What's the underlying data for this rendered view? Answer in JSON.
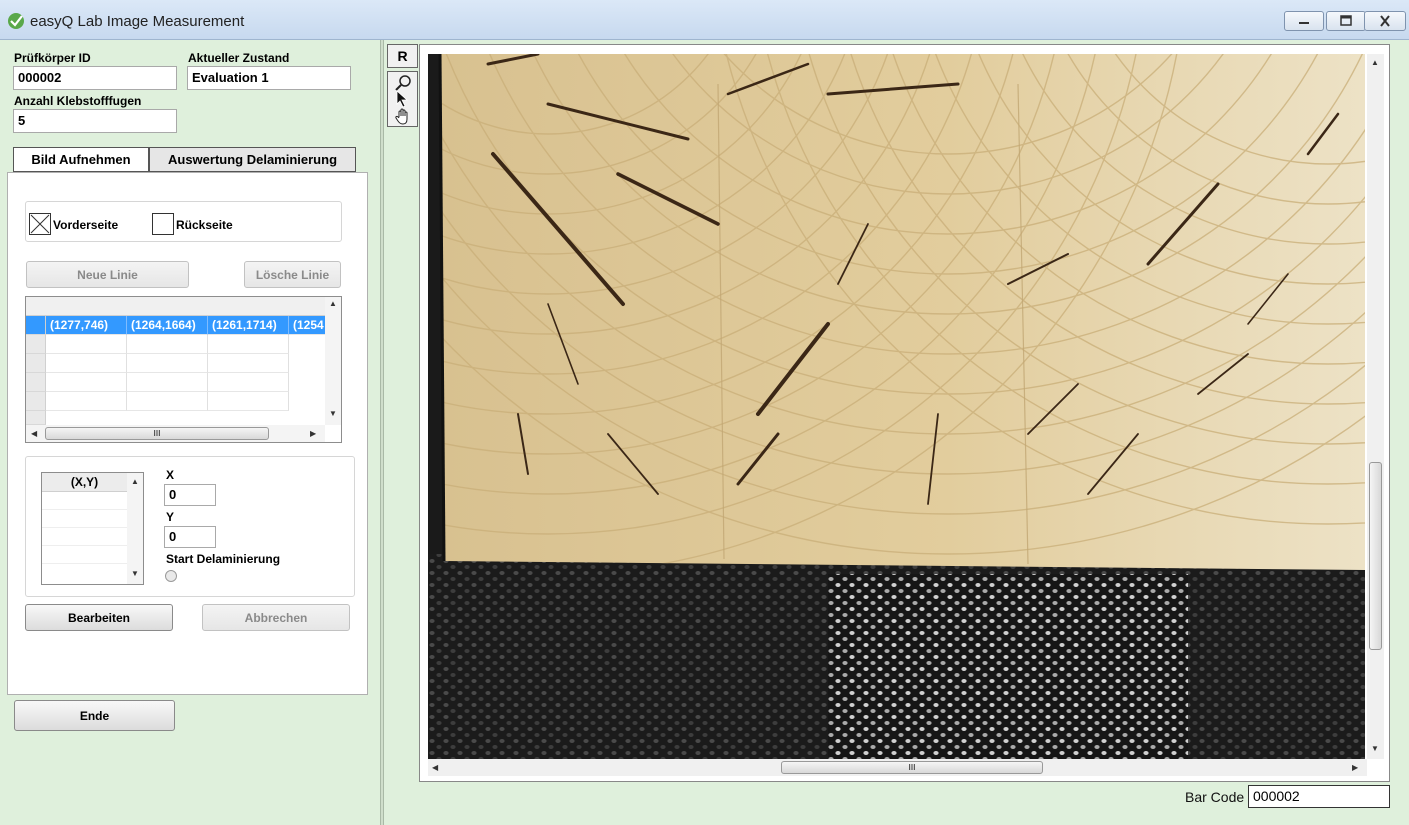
{
  "window": {
    "title": "easyQ Lab Image Measurement"
  },
  "form": {
    "pruefkoerper_label": "Prüfkörper ID",
    "pruefkoerper_value": "000002",
    "zustand_label": "Aktueller Zustand",
    "zustand_value": "Evaluation 1",
    "klebstoff_label": "Anzahl Klebstofffugen",
    "klebstoff_value": "5"
  },
  "tabs": [
    {
      "label": "Bild Aufnehmen",
      "active": true
    },
    {
      "label": "Auswertung Delaminierung",
      "active": false
    }
  ],
  "side": {
    "vorderseite_label": "Vorderseite",
    "vorderseite_checked": true,
    "rueckseite_label": "Rückseite",
    "rueckseite_checked": false
  },
  "line_buttons": {
    "neue": "Neue Linie",
    "loesche": "Lösche Linie"
  },
  "lines_grid": {
    "selected_row": [
      "(1277,746)",
      "(1264,1664)",
      "(1261,1714)",
      "(1254"
    ]
  },
  "points_list": {
    "header": "(X,Y)"
  },
  "coords": {
    "x_label": "X",
    "x_value": "0",
    "y_label": "Y",
    "y_value": "0",
    "start_label": "Start Delaminierung"
  },
  "actions": {
    "bearbeiten": "Bearbeiten",
    "abbrechen": "Abbrechen",
    "ende": "Ende"
  },
  "toolbar": {
    "reset_label": "R"
  },
  "image_scroll": {
    "h_grip": "III"
  },
  "footer": {
    "barcode_label": "Bar Code",
    "barcode_value": "000002"
  },
  "colors": {
    "selection": "#3399ff",
    "window_bg": "#dff0dc",
    "wood": "#e3cfa0",
    "belt": "#1c1c1c"
  }
}
